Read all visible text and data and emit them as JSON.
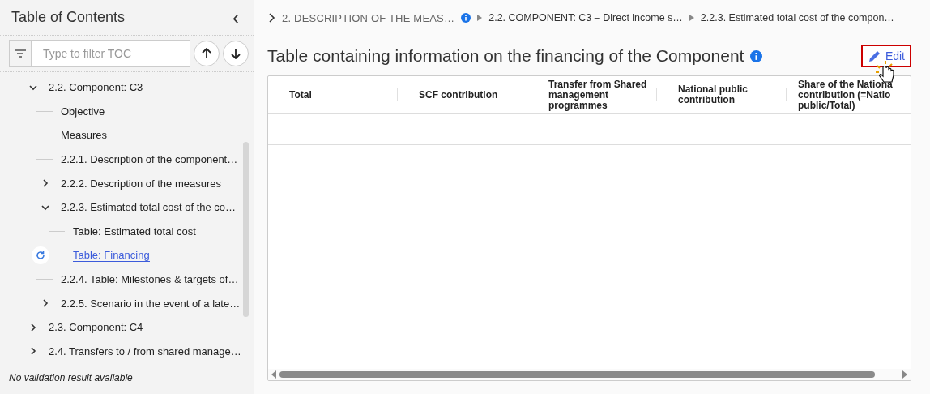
{
  "sidebar": {
    "title": "Table of Contents",
    "collapse_icon": "‹",
    "filter": {
      "placeholder": "Type to filter TOC"
    },
    "tree": [
      {
        "label": "2.2. Component: C3",
        "expanded": true,
        "selected": false,
        "children": [
          {
            "label": "Objective",
            "selected": false
          },
          {
            "label": "Measures",
            "selected": false
          },
          {
            "label": "2.2.1. Description of the component…",
            "selected": false
          },
          {
            "label": "2.2.2. Description of the measures",
            "expanded": false,
            "selected": false
          },
          {
            "label": "2.2.3. Estimated total cost of the co…",
            "expanded": true,
            "selected": false,
            "children": [
              {
                "label": "Table: Estimated total cost",
                "selected": false
              },
              {
                "label": "Table: Financing",
                "selected": true
              }
            ]
          },
          {
            "label": "2.2.4. Table: Milestones & targets of…",
            "selected": false
          },
          {
            "label": "2.2.5. Scenario in the event of a late…",
            "expanded": false,
            "selected": false
          }
        ]
      },
      {
        "label": "2.3. Component: C4",
        "expanded": false,
        "selected": false
      },
      {
        "label": "2.4. Transfers to / from shared manage…",
        "expanded": false,
        "selected": false
      }
    ],
    "status": "No validation result available"
  },
  "breadcrumb": [
    "2. DESCRIPTION OF THE MEAS…",
    "2.2. COMPONENT: C3 – Direct income s…",
    "2.2.3. Estimated total cost of the compon…"
  ],
  "heading": "Table containing information on the financing of the Component",
  "edit_button": "Edit",
  "table": {
    "columns": [
      "Total",
      "SCF contribution",
      "Transfer from Shared management programmes",
      "National public contribution",
      "Share of the Nationa contribution (=Natio public/Total)"
    ]
  }
}
